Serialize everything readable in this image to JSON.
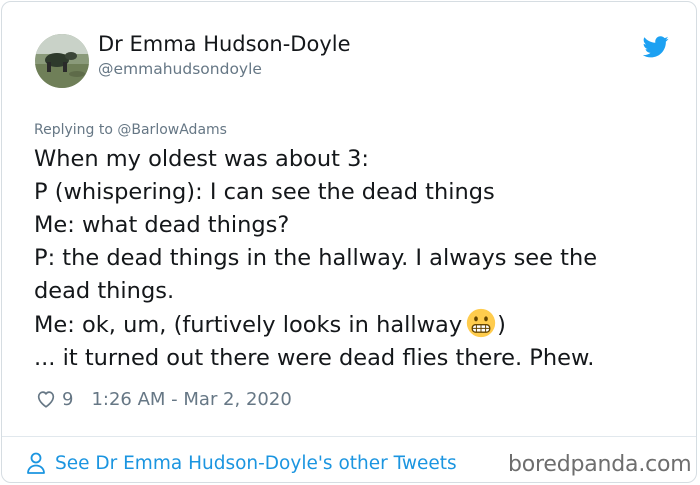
{
  "tweet": {
    "author": {
      "display_name": "Dr Emma Hudson-Doyle",
      "handle": "@emmahudsondoyle"
    },
    "replying_to": "Replying to @BarlowAdams",
    "lines": [
      "When my oldest was about 3:",
      "P (whispering): I can see the dead things",
      "Me: what dead things?",
      "P: the dead things in the hallway. I always see the",
      "dead things."
    ],
    "line_with_emoji": {
      "before": "Me: ok, um, (furtively looks in hallway",
      "emoji": "grimacing-face",
      "after": ")"
    },
    "last_line": "... it turned out there were dead flies there. Phew.",
    "likes": "9",
    "timestamp": "1:26 AM - Mar 2, 2020"
  },
  "footer": {
    "see_other_label": "See Dr Emma Hudson-Doyle's other Tweets"
  },
  "watermark": "boredpanda.com",
  "colors": {
    "link": "#1b95e0",
    "text": "#14171a",
    "muted": "#667785",
    "twitter_blue": "#1da1f2"
  },
  "icons": {
    "brand": "twitter-bird-icon",
    "like": "heart-icon",
    "profile": "person-icon"
  }
}
